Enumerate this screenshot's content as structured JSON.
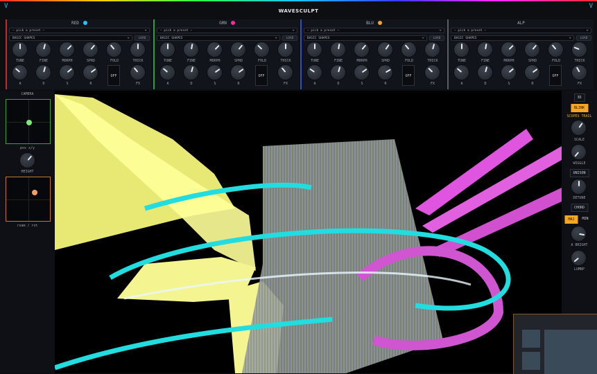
{
  "app": {
    "title": "WAVESCULPT",
    "corner_left": "V",
    "corner_right": "V"
  },
  "channels": [
    {
      "name": "RED",
      "dot_color": "#1ec8ff",
      "border_color": "#b83030",
      "preset_placeholder": "— pick a preset —",
      "bank": "BASIC SHAPES",
      "load_label": "LOAD",
      "row1": [
        "TUNE",
        "FINE",
        "MORPH",
        "SPRD",
        "FOLD",
        "THICK"
      ],
      "row2": [
        "A",
        "D",
        "S",
        "R",
        "",
        "FX"
      ],
      "off_label": "OFF"
    },
    {
      "name": "GRN",
      "dot_color": "#ff2a9a",
      "border_color": "#2aa040",
      "preset_placeholder": "— pick a preset —",
      "bank": "BASIC SHAPES",
      "load_label": "LOAD",
      "row1": [
        "TUNE",
        "FINE",
        "MORPH",
        "SPRD",
        "FOLD",
        "THICK"
      ],
      "row2": [
        "A",
        "D",
        "S",
        "R",
        "",
        "FX"
      ],
      "off_label": "OFF"
    },
    {
      "name": "BLU",
      "dot_color": "#f5a623",
      "border_color": "#3050c0",
      "preset_placeholder": "— pick a preset —",
      "bank": "BASIC SHAPES",
      "load_label": "LOAD",
      "row1": [
        "TUNE",
        "FINE",
        "MORPH",
        "SPRD",
        "FOLD",
        "THICK"
      ],
      "row2": [
        "A",
        "D",
        "S",
        "R",
        "",
        "FX"
      ],
      "off_label": "OFF"
    },
    {
      "name": "ALP",
      "dot_color": "",
      "border_color": "#5a5f68",
      "preset_placeholder": "— pick a preset —",
      "bank": "BASIC SHAPES",
      "load_label": "LOAD",
      "row1": [
        "TUNE",
        "FINE",
        "MORPH",
        "SPRD",
        "FOLD",
        "THICK"
      ],
      "row2": [
        "A",
        "D",
        "S",
        "R",
        "",
        "FX"
      ],
      "off_label": "OFF"
    }
  ],
  "camera": {
    "title": "CAMERA",
    "pad1_label": "pos x/y",
    "height_label": "HEIGHT",
    "pad2_label": "roam / rot",
    "pad1_point_color": "#7ee87e",
    "pad1_border": "#3aa040",
    "pad2_point_color": "#f5a060",
    "pad2_border": "#c07a30"
  },
  "right": {
    "btn_3d": "3D",
    "blink": "BLINK",
    "scopes_trail": "SCOPES TRAIL",
    "scale": "SCALE",
    "wiggle": "WIGGLE",
    "unison": "UNISON",
    "detune": "DETUNE",
    "chord": "CHORD",
    "maj": "MAJ",
    "min": "MIN",
    "a_bright": "A BRIGHT",
    "lumbp": "LUMBP",
    "accent": "#f5a623"
  }
}
